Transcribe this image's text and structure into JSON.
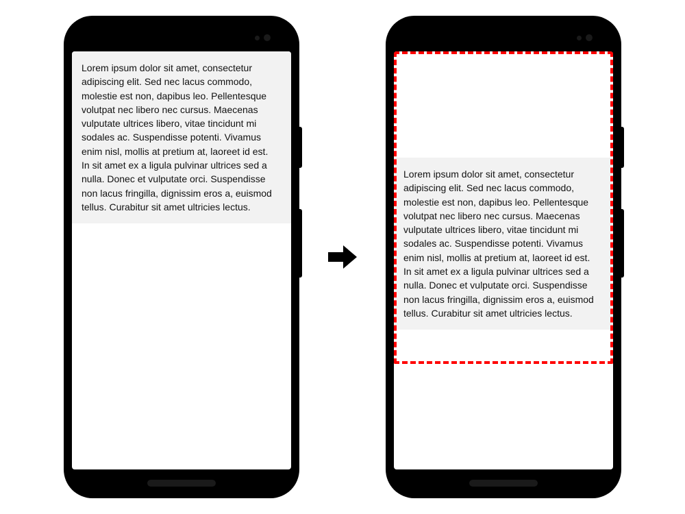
{
  "lorem_text": "Lorem ipsum dolor sit amet, consectetur adipiscing elit. Sed nec lacus commodo, molestie est non, dapibus leo. Pellentesque volutpat nec libero nec cursus. Maecenas vulputate ultrices libero, vitae tincidunt mi sodales ac. Suspendisse potenti. Vivamus enim nisl, mollis at pretium at, laoreet id est. In sit amet ex a ligula pulvinar ultrices sed a nulla. Donec et vulputate orci. Suspendisse non lacus fringilla, dignissim eros a, euismod tellus. Curabitur sit amet ultricies lectus.",
  "highlight_color": "#ff0000"
}
